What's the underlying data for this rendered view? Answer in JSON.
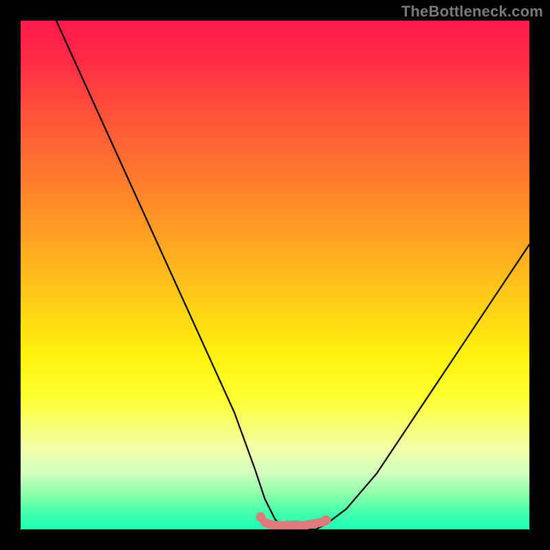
{
  "watermark": "TheBottleneck.com",
  "colors": {
    "pink_marker": "#e07a7a",
    "curve": "#000000",
    "gradient_top": "#ff1a4d",
    "gradient_bottom": "#19ffb8"
  },
  "chart_data": {
    "type": "line",
    "title": "",
    "xlabel": "",
    "ylabel": "",
    "xlim": [
      0,
      100
    ],
    "ylim": [
      0,
      100
    ],
    "grid": false,
    "series": [
      {
        "name": "bottleneck-curve",
        "x": [
          7,
          12,
          17,
          22,
          27,
          32,
          37,
          42,
          46,
          48,
          50,
          52,
          54,
          56,
          58,
          60,
          64,
          70,
          76,
          82,
          88,
          94,
          100
        ],
        "y": [
          100,
          89,
          78,
          67,
          56,
          45,
          34,
          23,
          12,
          6,
          2,
          0,
          0,
          0,
          0,
          1,
          4,
          11,
          20,
          29,
          38,
          47,
          56
        ],
        "note": "V-shaped curve with a flat minimum around x 52-58 at y=0"
      }
    ],
    "highlight": {
      "name": "optimal-band",
      "xrange": [
        48,
        60
      ],
      "y": 0,
      "note": "pink marker band at curve bottom indicating optimal region"
    },
    "background_gradient": {
      "stops": [
        {
          "pos": 0,
          "color": "#ff1a4d"
        },
        {
          "pos": 50,
          "color": "#ffd016"
        },
        {
          "pos": 75,
          "color": "#fdff30"
        },
        {
          "pos": 100,
          "color": "#19ffb8"
        }
      ],
      "note": "heat gradient, red (high bottleneck) at top to green (low) at bottom"
    }
  }
}
